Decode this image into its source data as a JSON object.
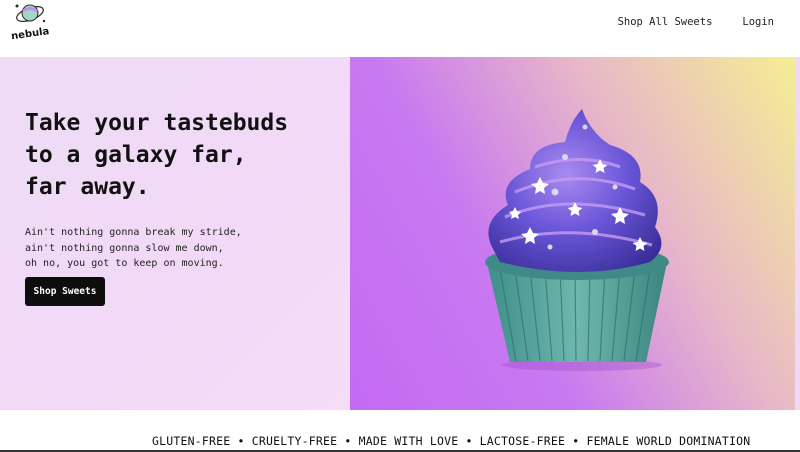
{
  "brand": {
    "name": "nebula"
  },
  "nav": {
    "items": [
      "Shop All Sweets",
      "Login"
    ]
  },
  "hero": {
    "headline": [
      "Take your tastebuds",
      "to a galaxy far,",
      "far away."
    ],
    "body": [
      "Ain't nothing gonna break my stride,",
      "ain't nothing gonna slow me down,",
      "oh no, you got to keep on moving."
    ],
    "cta_label": "Shop Sweets"
  },
  "tagline": "GLUTEN-FREE • CRUELTY-FREE • MADE WITH LOVE • LACTOSE-FREE • FEMALE WORLD DOMINATION",
  "colors": {
    "accent_pink": "#f2d9f7",
    "accent_purple": "#c46af3",
    "accent_yellow": "#f5ee93",
    "button": "#0d0d0d"
  }
}
